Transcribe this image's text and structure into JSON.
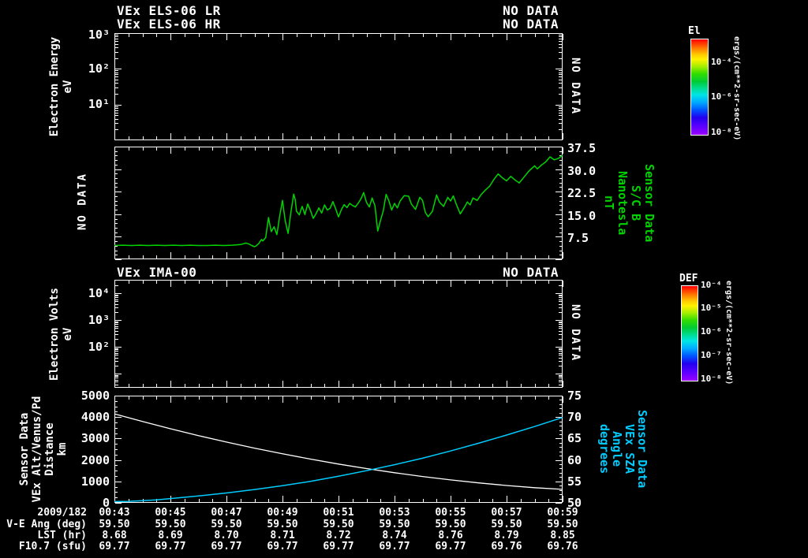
{
  "colors": {
    "green": "#00d400",
    "cyan": "#00ccff",
    "white": "#ffffff",
    "background": "#000000"
  },
  "header": {
    "title_lr": "VEx ELS-06 LR",
    "status_lr": "NO DATA",
    "title_hr": "VEx ELS-06 HR",
    "status_hr": "NO DATA"
  },
  "panel1": {
    "ylabel": "Electron Energy\neV",
    "yticks": [
      "10³",
      "10²",
      "10¹"
    ],
    "right_status": "NO DATA"
  },
  "colorbar_el": {
    "title": "El",
    "tick_labels": [
      "10⁻⁴",
      "10⁻⁶",
      "10⁻⁸"
    ],
    "unit": "ergs/(cm**2-sr-sec-eV)"
  },
  "panel2": {
    "left_status": "NO DATA",
    "right_ticks": [
      "37.5",
      "30.0",
      "22.5",
      "15.0",
      "7.5"
    ],
    "right_label": "Sensor Data\nS/C B\nNanotesla\nnT"
  },
  "panel3": {
    "title": "VEx IMA-00",
    "status": "NO DATA",
    "ylabel": "Electron Volts\neV",
    "yticks": [
      "10⁴",
      "10³",
      "10²"
    ],
    "right_status": "NO DATA"
  },
  "colorbar_def": {
    "title": "DEF",
    "tick_labels": [
      "10⁻⁴",
      "10⁻⁵",
      "10⁻⁶",
      "10⁻⁷",
      "10⁻⁸"
    ],
    "unit": "ergs/(cm**2-sr-sec-eV)"
  },
  "panel4": {
    "left_label": "Sensor Data\nVEx Alt/Venus/Pd\nDistance\nkm",
    "left_ticks": [
      "5000",
      "4000",
      "3000",
      "2000",
      "1000",
      "0"
    ],
    "right_ticks": [
      "75",
      "70",
      "65",
      "60",
      "55",
      "50"
    ],
    "right_label": "Sensor Data\nVEx SZA\nAngle\ndegrees"
  },
  "xaxis": {
    "date": "2009/182",
    "ticks": [
      "00:43",
      "00:45",
      "00:47",
      "00:49",
      "00:51",
      "00:53",
      "00:55",
      "00:57",
      "00:59"
    ]
  },
  "table": {
    "rows": [
      {
        "label": "V-E Ang (deg)",
        "values": [
          "59.50",
          "59.50",
          "59.50",
          "59.50",
          "59.50",
          "59.50",
          "59.50",
          "59.50",
          "59.50"
        ]
      },
      {
        "label": "LST (hr)",
        "values": [
          "8.68",
          "8.69",
          "8.70",
          "8.71",
          "8.72",
          "8.74",
          "8.76",
          "8.79",
          "8.85"
        ]
      },
      {
        "label": "F10.7 (sfu)",
        "values": [
          "69.77",
          "69.77",
          "69.77",
          "69.77",
          "69.77",
          "69.77",
          "69.77",
          "69.76",
          "69.76"
        ]
      }
    ]
  },
  "chart_data": [
    {
      "id": "els_electron_energy_spectrogram",
      "type": "heatmap",
      "title": "VEx ELS-06 LR / VEx ELS-06 HR",
      "status": "NO DATA",
      "ylabel": "Electron Energy eV",
      "yscale": "log",
      "ylim": [
        1,
        1000
      ],
      "ytick_values": [
        10,
        100,
        1000
      ],
      "colorbar": {
        "title": "El",
        "unit": "ergs/(cm**2-sr-sec-eV)",
        "tick_values": [
          0.0001,
          1e-06,
          1e-08
        ]
      },
      "values": []
    },
    {
      "id": "magnetic_field",
      "type": "line",
      "left_status": "NO DATA",
      "ylabel_right": "Sensor Data S/C B Nanotesla nT",
      "ylim": [
        0,
        37.5
      ],
      "ytick_values": [
        7.5,
        15.0,
        22.5,
        30.0,
        37.5
      ],
      "x_start": "00:43",
      "x_end": "00:59",
      "x_span_minutes": 16,
      "x_major_tick_minutes": 2,
      "series": [
        {
          "name": "S/C B (nT)",
          "color": "#00d400",
          "axis": "right",
          "points": [
            [
              0,
              4.6
            ],
            [
              0.3,
              4.7
            ],
            [
              0.6,
              4.6
            ],
            [
              0.9,
              4.7
            ],
            [
              1.2,
              4.6
            ],
            [
              1.5,
              4.7
            ],
            [
              1.8,
              4.6
            ],
            [
              2.1,
              4.7
            ],
            [
              2.4,
              4.6
            ],
            [
              2.7,
              4.7
            ],
            [
              3.0,
              4.6
            ],
            [
              3.3,
              4.6
            ],
            [
              3.6,
              4.7
            ],
            [
              3.9,
              4.6
            ],
            [
              4.2,
              4.7
            ],
            [
              4.5,
              4.9
            ],
            [
              4.7,
              5.4
            ],
            [
              4.8,
              5.1
            ],
            [
              4.9,
              4.6
            ],
            [
              5.0,
              4.2
            ],
            [
              5.05,
              4.4
            ],
            [
              5.15,
              5.2
            ],
            [
              5.25,
              6.6
            ],
            [
              5.3,
              6.1
            ],
            [
              5.4,
              7.2
            ],
            [
              5.5,
              13.9
            ],
            [
              5.55,
              11.5
            ],
            [
              5.6,
              9.2
            ],
            [
              5.7,
              10.8
            ],
            [
              5.8,
              8.2
            ],
            [
              5.9,
              14.5
            ],
            [
              6.0,
              19.6
            ],
            [
              6.05,
              16.0
            ],
            [
              6.1,
              12.8
            ],
            [
              6.2,
              8.6
            ],
            [
              6.3,
              15.5
            ],
            [
              6.4,
              21.7
            ],
            [
              6.45,
              20.0
            ],
            [
              6.5,
              16.0
            ],
            [
              6.6,
              14.8
            ],
            [
              6.7,
              17.6
            ],
            [
              6.8,
              14.9
            ],
            [
              6.9,
              18.4
            ],
            [
              7.0,
              16.2
            ],
            [
              7.1,
              13.6
            ],
            [
              7.2,
              15.2
            ],
            [
              7.3,
              17.1
            ],
            [
              7.4,
              15.4
            ],
            [
              7.5,
              18.1
            ],
            [
              7.6,
              16.4
            ],
            [
              7.7,
              17.0
            ],
            [
              7.8,
              19.2
            ],
            [
              7.9,
              16.8
            ],
            [
              8.0,
              14.1
            ],
            [
              8.1,
              16.5
            ],
            [
              8.2,
              18.2
            ],
            [
              8.3,
              17.2
            ],
            [
              8.4,
              18.6
            ],
            [
              8.5,
              17.9
            ],
            [
              8.6,
              17.4
            ],
            [
              8.7,
              18.6
            ],
            [
              8.8,
              20.1
            ],
            [
              8.9,
              22.2
            ],
            [
              9.0,
              18.9
            ],
            [
              9.1,
              17.4
            ],
            [
              9.2,
              20.4
            ],
            [
              9.3,
              17.8
            ],
            [
              9.4,
              9.4
            ],
            [
              9.5,
              13.0
            ],
            [
              9.6,
              16.2
            ],
            [
              9.7,
              21.6
            ],
            [
              9.8,
              19.4
            ],
            [
              9.9,
              16.4
            ],
            [
              10.0,
              18.6
            ],
            [
              10.1,
              17.1
            ],
            [
              10.2,
              19.4
            ],
            [
              10.35,
              21.2
            ],
            [
              10.5,
              21.0
            ],
            [
              10.6,
              18.4
            ],
            [
              10.75,
              16.6
            ],
            [
              10.9,
              20.6
            ],
            [
              11.0,
              19.6
            ],
            [
              11.1,
              15.6
            ],
            [
              11.2,
              14.2
            ],
            [
              11.35,
              15.9
            ],
            [
              11.5,
              21.4
            ],
            [
              11.6,
              19.1
            ],
            [
              11.75,
              17.6
            ],
            [
              11.9,
              20.6
            ],
            [
              12.0,
              19.4
            ],
            [
              12.1,
              21.1
            ],
            [
              12.2,
              18.4
            ],
            [
              12.35,
              15.1
            ],
            [
              12.5,
              17.4
            ],
            [
              12.6,
              19.1
            ],
            [
              12.7,
              18.1
            ],
            [
              12.8,
              20.4
            ],
            [
              12.95,
              19.6
            ],
            [
              13.1,
              21.6
            ],
            [
              13.25,
              23.1
            ],
            [
              13.4,
              24.4
            ],
            [
              13.55,
              26.6
            ],
            [
              13.7,
              28.4
            ],
            [
              13.85,
              27.1
            ],
            [
              14.0,
              26.1
            ],
            [
              14.15,
              27.6
            ],
            [
              14.3,
              26.4
            ],
            [
              14.45,
              25.4
            ],
            [
              14.6,
              27.1
            ],
            [
              14.8,
              29.4
            ],
            [
              15.0,
              31.1
            ],
            [
              15.1,
              30.1
            ],
            [
              15.25,
              31.4
            ],
            [
              15.4,
              32.4
            ],
            [
              15.55,
              34.1
            ],
            [
              15.7,
              33.1
            ],
            [
              15.85,
              33.6
            ],
            [
              16.0,
              34.6
            ]
          ]
        }
      ]
    },
    {
      "id": "ima_ion_spectrogram",
      "type": "heatmap",
      "title": "VEx IMA-00",
      "status": "NO DATA",
      "ylabel": "Electron Volts eV",
      "yscale": "log",
      "ylim": [
        3,
        31623
      ],
      "ytick_values": [
        100,
        1000,
        10000
      ],
      "colorbar": {
        "title": "DEF",
        "unit": "ergs/(cm**2-sr-sec-eV)",
        "tick_values": [
          0.0001,
          1e-05,
          1e-06,
          1e-07,
          1e-08
        ]
      },
      "values": []
    },
    {
      "id": "ephemeris",
      "type": "line",
      "ylabel_left": "Sensor Data VEx Alt/Venus/Pd Distance km",
      "ylabel_right": "Sensor Data VEx SZA Angle degrees",
      "ylim_left": [
        0,
        5000
      ],
      "ylim_right": [
        50,
        75
      ],
      "ytick_values_left": [
        0,
        1000,
        2000,
        3000,
        4000,
        5000
      ],
      "ytick_values_right": [
        50,
        55,
        60,
        65,
        70,
        75
      ],
      "x_start": "00:43",
      "x_end": "00:59",
      "x_span_minutes": 16,
      "x_major_tick_minutes": 2,
      "series": [
        {
          "name": "VEx Altitude (km)",
          "color": "#ffffff",
          "axis": "left",
          "points": [
            [
              0,
              4150
            ],
            [
              1,
              3794
            ],
            [
              2,
              3457
            ],
            [
              3,
              3137
            ],
            [
              4,
              2836
            ],
            [
              5,
              2553
            ],
            [
              6,
              2287
            ],
            [
              7,
              2040
            ],
            [
              8,
              1810
            ],
            [
              9,
              1599
            ],
            [
              10,
              1405
            ],
            [
              11,
              1229
            ],
            [
              12,
              1071
            ],
            [
              13,
              931
            ],
            [
              14,
              809
            ],
            [
              15,
              705
            ],
            [
              16,
              630
            ]
          ]
        },
        {
          "name": "VEx SZA (deg)",
          "color": "#00ccff",
          "axis": "right",
          "points": [
            [
              0,
              50.3
            ],
            [
              0.5,
              50.35
            ],
            [
              1,
              50.5
            ],
            [
              1.5,
              50.7
            ],
            [
              2,
              51.0
            ],
            [
              3,
              51.6
            ],
            [
              4,
              52.3
            ],
            [
              5,
              53.1
            ],
            [
              6,
              54.0
            ],
            [
              7,
              55.0
            ],
            [
              8,
              56.2
            ],
            [
              9,
              57.5
            ],
            [
              10,
              58.9
            ],
            [
              11,
              60.4
            ],
            [
              12,
              62.1
            ],
            [
              13,
              63.9
            ],
            [
              14,
              65.8
            ],
            [
              15,
              67.8
            ],
            [
              16,
              69.9
            ]
          ]
        }
      ]
    }
  ]
}
